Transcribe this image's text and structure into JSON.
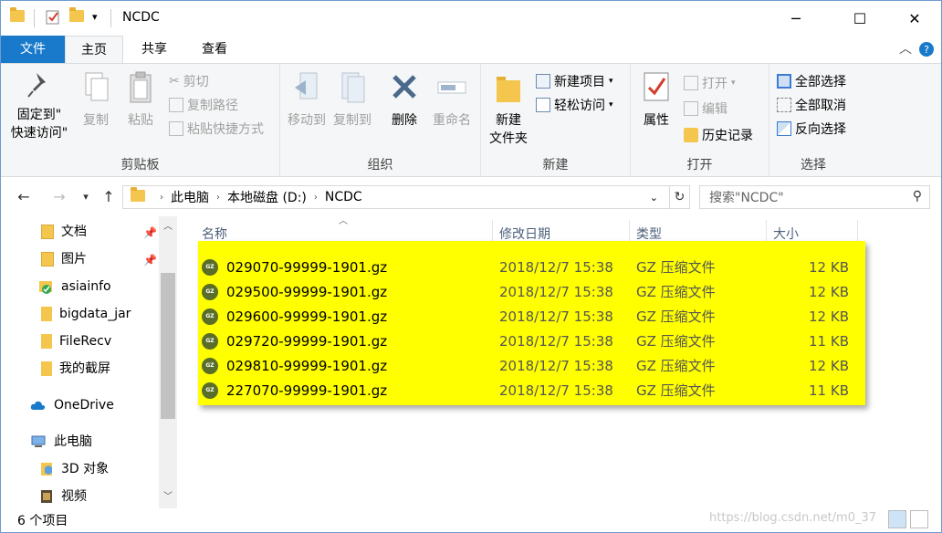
{
  "window": {
    "title": "NCDC",
    "minimize": "─",
    "maximize": "☐",
    "close": "✕"
  },
  "ribbon_tabs": [
    {
      "label": "文件"
    },
    {
      "label": "主页"
    },
    {
      "label": "共享"
    },
    {
      "label": "查看"
    }
  ],
  "ribbon": {
    "clipboard": {
      "label": "剪贴板",
      "pin_line1": "固定到\"",
      "pin_line2": "快速访问\"",
      "copy": "复制",
      "paste": "粘贴",
      "cut": "剪切",
      "copy_path": "复制路径",
      "paste_shortcut": "粘贴快捷方式"
    },
    "organize": {
      "label": "组织",
      "move_to": "移动到",
      "copy_to": "复制到",
      "delete": "删除",
      "rename": "重命名"
    },
    "new": {
      "label": "新建",
      "new_folder_line1": "新建",
      "new_folder_line2": "文件夹",
      "new_item": "新建项目",
      "easy_access": "轻松访问"
    },
    "open": {
      "label": "打开",
      "properties": "属性",
      "open": "打开",
      "edit": "编辑",
      "history": "历史记录"
    },
    "select": {
      "label": "选择",
      "select_all": "全部选择",
      "select_none": "全部取消",
      "invert": "反向选择"
    }
  },
  "address": {
    "crumbs": [
      "此电脑",
      "本地磁盘 (D:)",
      "NCDC"
    ],
    "search_placeholder": "搜索\"NCDC\""
  },
  "sidebar": {
    "items": [
      {
        "label": "文档",
        "pinned": true
      },
      {
        "label": "图片",
        "pinned": true
      },
      {
        "label": "asiainfo"
      },
      {
        "label": "bigdata_jar"
      },
      {
        "label": "FileRecv"
      },
      {
        "label": "我的截屏"
      },
      {
        "label": "OneDrive"
      },
      {
        "label": "此电脑"
      },
      {
        "label": "3D 对象"
      },
      {
        "label": "视频"
      }
    ]
  },
  "columns": {
    "name": "名称",
    "date": "修改日期",
    "type": "类型",
    "size": "大小"
  },
  "files": [
    {
      "name": "029070-99999-1901.gz",
      "date": "2018/12/7 15:38",
      "type": "GZ 压缩文件",
      "size": "12 KB"
    },
    {
      "name": "029500-99999-1901.gz",
      "date": "2018/12/7 15:38",
      "type": "GZ 压缩文件",
      "size": "12 KB"
    },
    {
      "name": "029600-99999-1901.gz",
      "date": "2018/12/7 15:38",
      "type": "GZ 压缩文件",
      "size": "12 KB"
    },
    {
      "name": "029720-99999-1901.gz",
      "date": "2018/12/7 15:38",
      "type": "GZ 压缩文件",
      "size": "11 KB"
    },
    {
      "name": "029810-99999-1901.gz",
      "date": "2018/12/7 15:38",
      "type": "GZ 压缩文件",
      "size": "12 KB"
    },
    {
      "name": "227070-99999-1901.gz",
      "date": "2018/12/7 15:38",
      "type": "GZ 压缩文件",
      "size": "11 KB"
    }
  ],
  "status": {
    "item_count": "6 个项目",
    "watermark": "https://blog.csdn.net/m0_37"
  },
  "colors": {
    "accent": "#1979ca",
    "highlight": "#ffff00"
  }
}
